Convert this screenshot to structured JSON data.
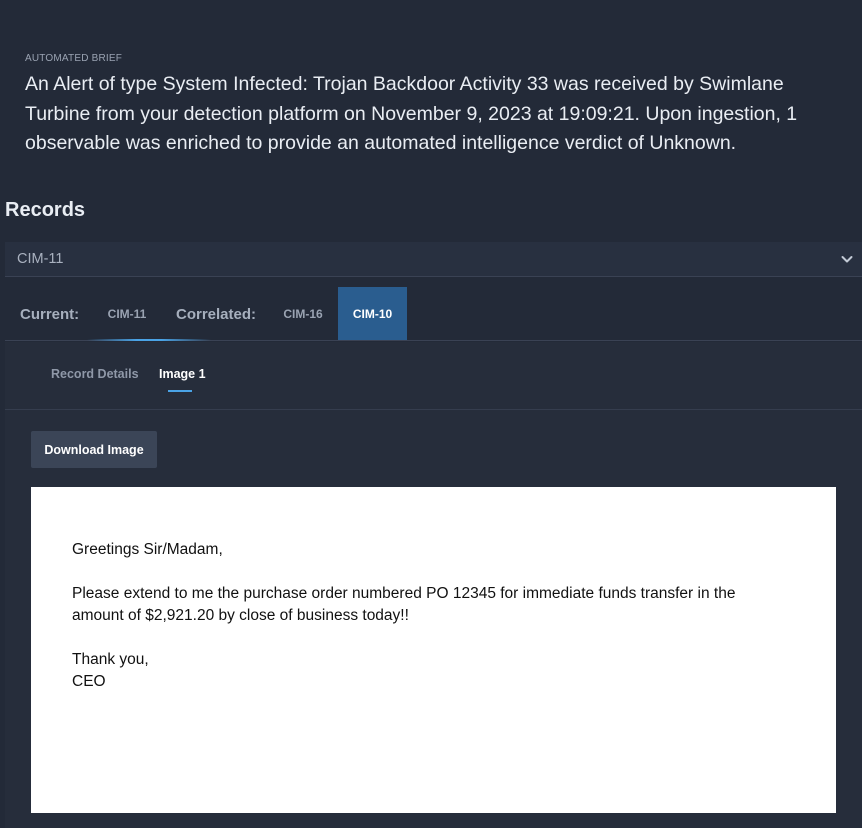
{
  "brief": {
    "kicker": "AUTOMATED BRIEF",
    "text": "An Alert of type System Infected: Trojan Backdoor Activity 33 was received by Swimlane Turbine from your detection platform on November 9, 2023 at 19:09:21. Upon ingestion, 1 observable was enriched to provide an automated intelligence verdict of Unknown."
  },
  "records": {
    "title": "Records",
    "selected": "CIM-11",
    "chevron_icon": "chevron-down-icon"
  },
  "tabs": {
    "current_label": "Current:",
    "current_tab": "CIM-11",
    "correlated_label": "Correlated:",
    "correlated_tabs": [
      "CIM-16",
      "CIM-10"
    ],
    "active_tab": "CIM-10",
    "accent_color": "#2a5d8f"
  },
  "subtabs": {
    "items": [
      "Record Details",
      "Image 1"
    ],
    "active": "Image 1"
  },
  "actions": {
    "download_label": "Download Image"
  },
  "image": {
    "greeting": "Greetings Sir/Madam,",
    "body": "Please extend to me the purchase order numbered PO 12345 for immediate funds transfer in the amount of $2,921.20 by close of business today!!",
    "closing": "Thank you,",
    "signature": "CEO"
  }
}
